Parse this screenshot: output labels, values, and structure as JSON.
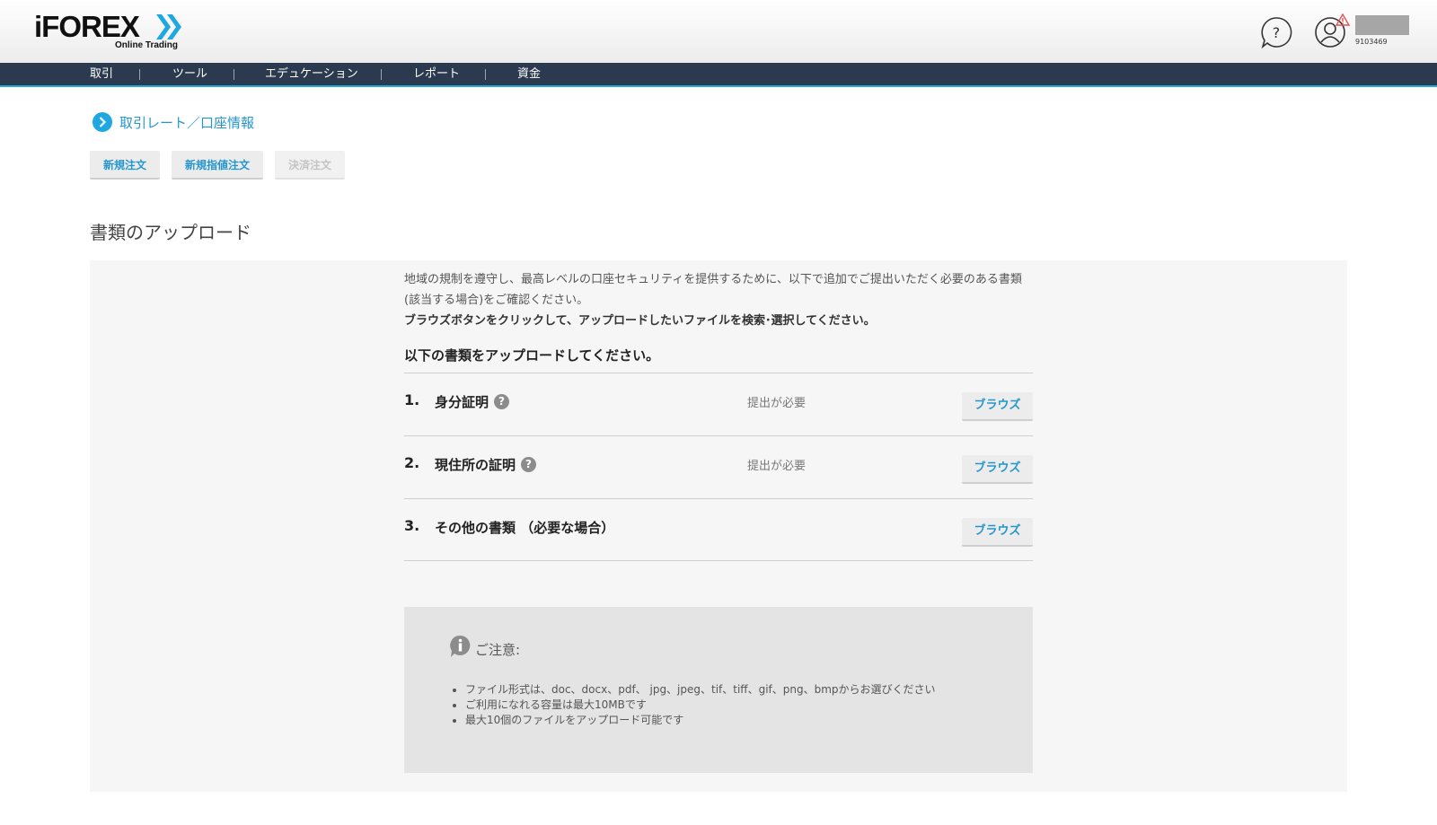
{
  "brand": {
    "logo": "iFOREX",
    "tagline": "Online Trading"
  },
  "header": {
    "account_id": "9103469",
    "icons": [
      "help-icon",
      "user-icon",
      "warning-icon"
    ]
  },
  "nav": {
    "items": [
      {
        "label": "取引"
      },
      {
        "label": "ツール"
      },
      {
        "label": "エデュケーション"
      },
      {
        "label": "レポート"
      },
      {
        "label": "資金"
      }
    ]
  },
  "breadcrumb": {
    "label": "取引レート／口座情報"
  },
  "order_buttons": {
    "new_order": "新規注文",
    "new_limit_order": "新規指値注文",
    "close_order": "決済注文"
  },
  "page": {
    "title": "書類のアップロード",
    "intro_line1": "地域の規制を遵守し、最高レベルの口座セキュリティを提供するために、以下で追加でご提出いただく必要のある書類",
    "intro_line2": "(該当する場合)をご確認ください。",
    "intro_line3": "ブラウズボタンをクリックして、アップロードしたいファイルを検索･選択してください。",
    "section_title": "以下の書類をアップロードしてください。"
  },
  "documents": [
    {
      "num": "1.",
      "label": "身分証明",
      "status": "提出が必要",
      "browse": "ブラウズ"
    },
    {
      "num": "2.",
      "label": "現住所の証明",
      "status": "提出が必要",
      "browse": "ブラウズ"
    },
    {
      "num": "3.",
      "label": "その他の書類 （必要な場合）",
      "status": "",
      "browse": "ブラウズ"
    }
  ],
  "notice": {
    "title": "ご注意:",
    "items": [
      "ファイル形式は、doc、docx、pdf、 jpg、jpeg、tif、tiff、gif、png、bmpからお選びください",
      "ご利用になれる容量は最大10MBです",
      "最大10個のファイルをアップロード可能です"
    ]
  },
  "colors": {
    "nav_bg": "#2b3a4e",
    "accent": "#29a8d8",
    "link": "#2596cc",
    "panel_bg": "#f6f6f6",
    "notice_bg": "#e4e4e4"
  }
}
